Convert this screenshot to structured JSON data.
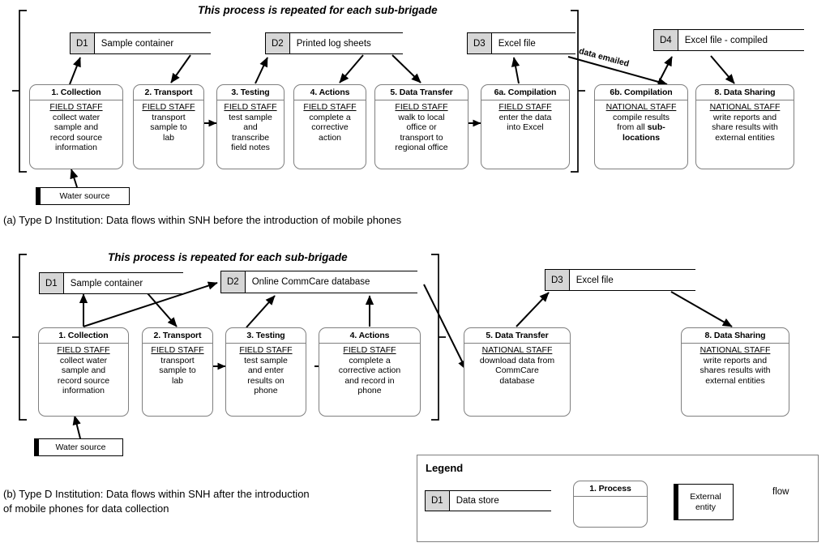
{
  "figure": {
    "diagram_a": {
      "repeat_note": "This process is repeated for each sub-brigade",
      "caption": "(a) Type D Institution: Data flows within SNH before the introduction of mobile phones",
      "stores": [
        {
          "id": "D1",
          "label": "Sample container"
        },
        {
          "id": "D2",
          "label": "Printed log sheets"
        },
        {
          "id": "D3",
          "label": "Excel file"
        },
        {
          "id": "D4",
          "label": "Excel file - compiled"
        }
      ],
      "entities": [
        {
          "label": "Water source"
        }
      ],
      "flow_labels": [
        {
          "label": "data emailed"
        }
      ],
      "processes": [
        {
          "title": "1. Collection",
          "role": "FIELD STAFF",
          "lines": [
            "collect water",
            "sample and",
            "record source",
            "information"
          ]
        },
        {
          "title": "2. Transport",
          "role": "FIELD STAFF",
          "lines": [
            "transport",
            "sample to",
            "lab"
          ]
        },
        {
          "title": "3. Testing",
          "role": "FIELD STAFF",
          "lines": [
            "test sample",
            "and",
            "transcribe",
            "field notes"
          ]
        },
        {
          "title": "4. Actions",
          "role": "FIELD STAFF",
          "lines": [
            "complete a",
            "corrective",
            "action"
          ]
        },
        {
          "title": "5. Data Transfer",
          "role": "FIELD STAFF",
          "lines": [
            "walk to local",
            "office or",
            "transport to",
            "regional office"
          ]
        },
        {
          "title": "6a. Compilation",
          "role": "FIELD STAFF",
          "lines": [
            "enter the data",
            "into Excel"
          ]
        },
        {
          "title": "6b. Compilation",
          "role": "NATIONAL STAFF",
          "lines": [
            "compile results",
            "from all <b>sub-</b>",
            "<b>locations</b>"
          ]
        },
        {
          "title": "8. Data Sharing",
          "role": "NATIONAL STAFF",
          "lines": [
            "write reports and",
            "share results with",
            "external entities"
          ]
        }
      ]
    },
    "diagram_b": {
      "repeat_note": "This process is repeated for each sub-brigade",
      "caption_line1": "(b) Type D Institution: Data flows within SNH after the introduction",
      "caption_line2": "of mobile phones for data collection",
      "stores": [
        {
          "id": "D1",
          "label": "Sample container"
        },
        {
          "id": "D2",
          "label": "Online CommCare database"
        },
        {
          "id": "D3",
          "label": "Excel file"
        }
      ],
      "entities": [
        {
          "label": "Water source"
        }
      ],
      "processes": [
        {
          "title": "1. Collection",
          "role": "FIELD STAFF",
          "lines": [
            "collect water",
            "sample and",
            "record source",
            "information"
          ]
        },
        {
          "title": "2. Transport",
          "role": "FIELD STAFF",
          "lines": [
            "transport",
            "sample to",
            "lab"
          ]
        },
        {
          "title": "3. Testing",
          "role": "FIELD STAFF",
          "lines": [
            "test sample",
            "and enter",
            "results on",
            "phone"
          ]
        },
        {
          "title": "4. Actions",
          "role": "FIELD STAFF",
          "lines": [
            "complete a",
            "corrective action",
            "and record in",
            "phone"
          ]
        },
        {
          "title": "5. Data Transfer",
          "role": "NATIONAL STAFF",
          "lines": [
            "download data from",
            "CommCare",
            "database"
          ]
        },
        {
          "title": "8. Data Sharing",
          "role": "NATIONAL STAFF",
          "lines": [
            "write reports and",
            "shares results with",
            "external entities"
          ]
        }
      ]
    },
    "legend": {
      "title": "Legend",
      "store": {
        "id": "D1",
        "label": "Data store"
      },
      "process": {
        "title": "1. Process"
      },
      "entity": {
        "line1": "External",
        "line2": "entity"
      },
      "flow": {
        "label": "flow"
      }
    },
    "colors": {
      "store_fill": "#d6d6d6",
      "process_border": "#7f7f7f",
      "line": "#000000",
      "background": "#ffffff"
    }
  }
}
